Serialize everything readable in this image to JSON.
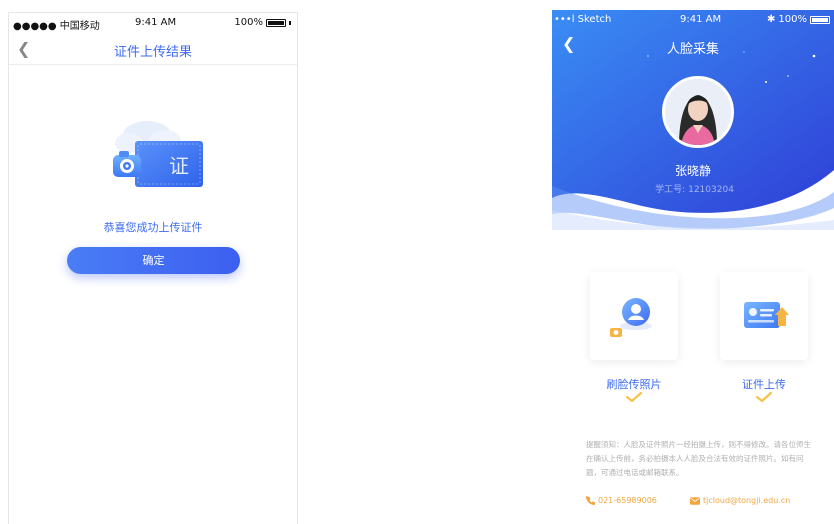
{
  "left_screen": {
    "status_bar": {
      "carrier": "●●●●● 中国移动",
      "time": "9:41 AM",
      "battery": "100%"
    },
    "nav": {
      "title": "证件上传结果"
    },
    "illustration": {
      "badge_text": "证"
    },
    "success_message": "恭喜您成功上传证件",
    "confirm_button": "确定"
  },
  "right_screen": {
    "status_bar": {
      "signal": "•••l Sketch",
      "time": "9:41 AM",
      "battery": "100%"
    },
    "nav": {
      "title": "人脸采集"
    },
    "profile": {
      "name": "张晓静",
      "id_label": "学工号:",
      "id_value": "12103204"
    },
    "actions": [
      {
        "label": "刷脸传照片",
        "done": true
      },
      {
        "label": "证件上传",
        "done": true
      }
    ],
    "notice": "提醒须知：人脸及证件照片一经拍摄上传，则不得修改。请各位师生在确认上传前，务必拍摄本人人脸及合法有效的证件照片。如有问题，可通过电话或邮箱联系。",
    "contact": {
      "phone": "021-65989006",
      "email": "tjcloud@tongji.edu.cn"
    }
  },
  "colors": {
    "primary": "#3d6bf0",
    "header_gradient_start": "#3a8df5",
    "header_gradient_end": "#2f3fd6",
    "accent_orange": "#f2a640",
    "check_yellow": "#f5c34a"
  },
  "icons": [
    "back-chevron-icon",
    "camera-icon",
    "id-card-icon",
    "face-scan-icon",
    "checkmark-icon",
    "phone-icon",
    "mail-icon"
  ]
}
